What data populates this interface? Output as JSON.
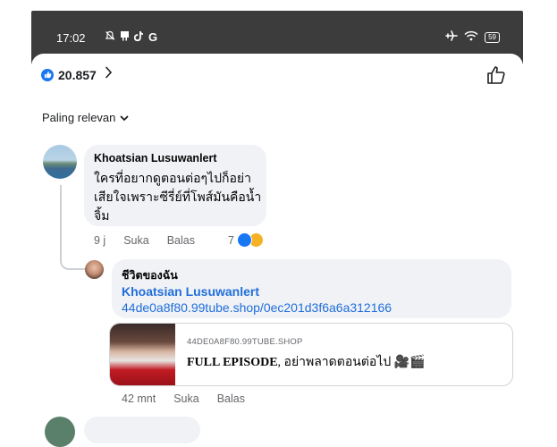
{
  "status_bar": {
    "time": "17:02",
    "left_icons": [
      "notifications-off-icon",
      "flag-icon",
      "tiktok-icon",
      "google-icon"
    ],
    "battery": "59"
  },
  "header": {
    "reaction_count": "20.857",
    "sort_label": "Paling relevan"
  },
  "comments": [
    {
      "author": "Khoatsian Lusuwanlert",
      "text": "ใครที่อยากดูตอนต่อๆไปก็อย่าเสียใจเพราะซีรี่ย์ที่โพส์มันคือน้ำจิ้ม",
      "time": "9 j",
      "like_label": "Suka",
      "reply_label": "Balas",
      "reaction_count": "7",
      "reply": {
        "author": "ชีวิตของฉัน",
        "mention": "Khoatsian Lusuwanlert",
        "link_text": "44de0a8f80.99tube.shop/0ec201d3f6a6a312166",
        "card": {
          "domain": "44DE0A8F80.99TUBE.SHOP",
          "title_bold": "FULL EPISODE",
          "title_rest": ", อย่าพลาดตอนต่อไป 🎥🎬"
        },
        "time": "42 mnt",
        "like_label": "Suka",
        "reply_label": "Balas"
      }
    }
  ],
  "colors": {
    "accent": "#1877f2",
    "link": "#216fdb",
    "bubble": "#f0f2f5",
    "status_bar": "#3c3c3c"
  }
}
